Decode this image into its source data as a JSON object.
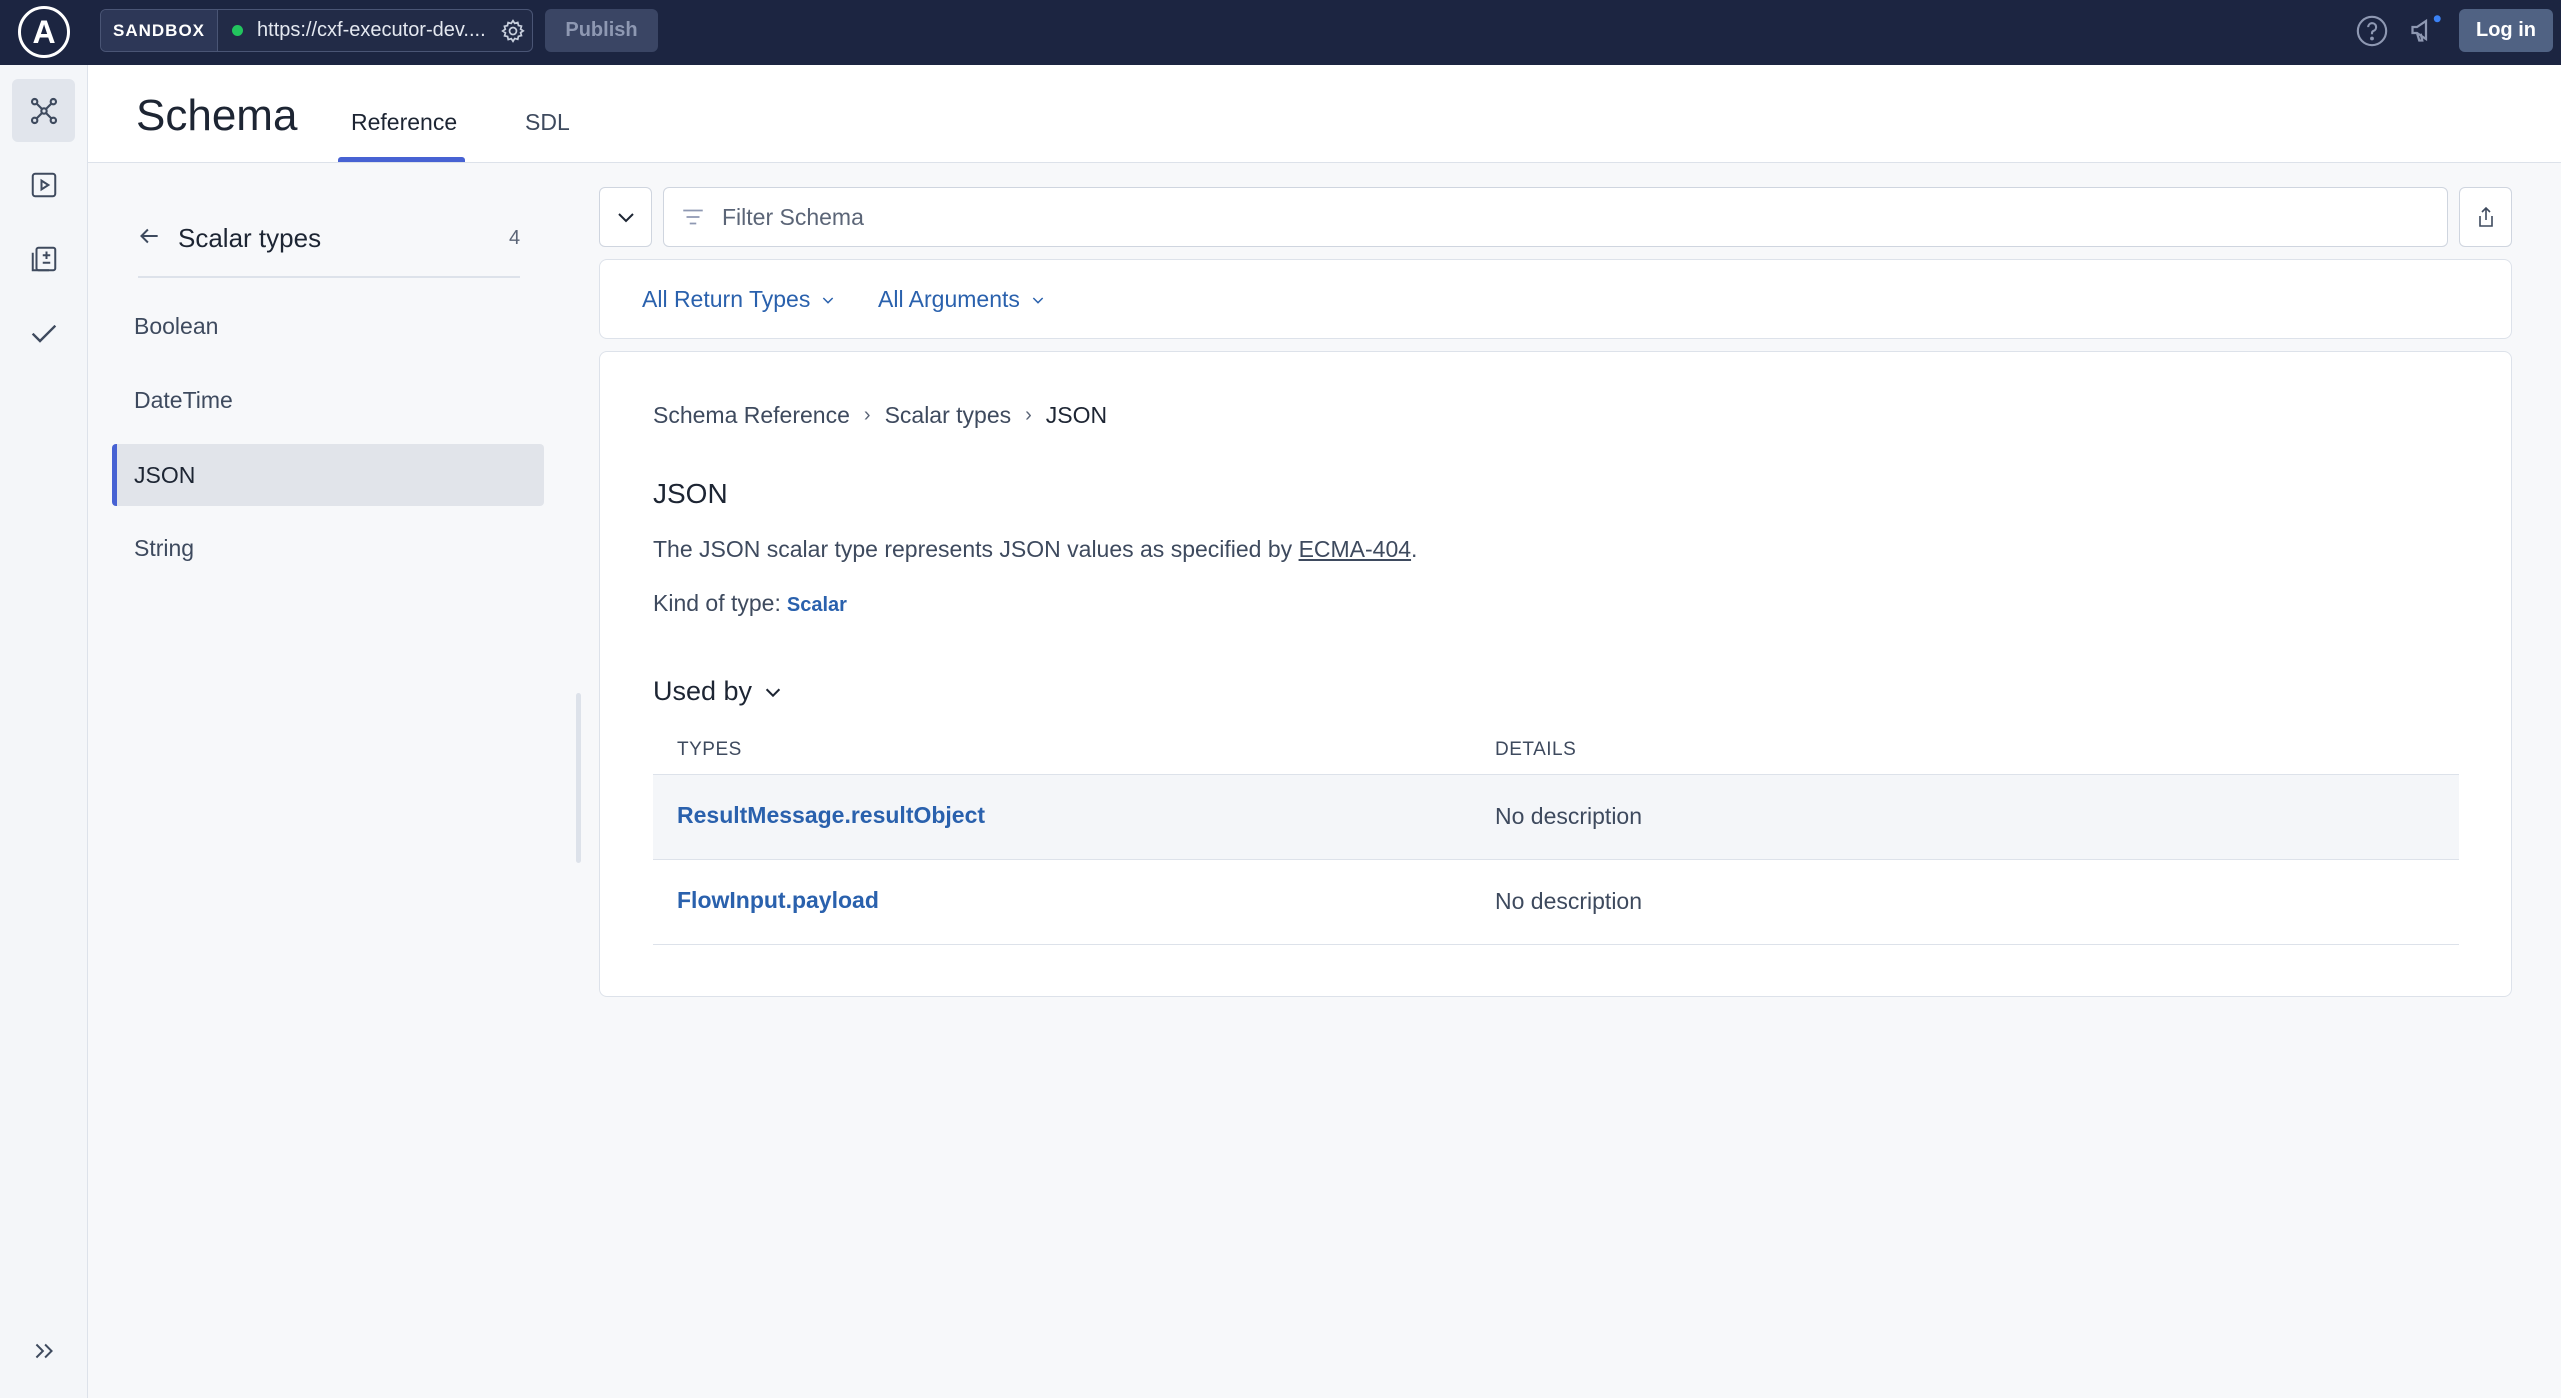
{
  "topbar": {
    "logo_letter": "A",
    "sandbox_label": "SANDBOX",
    "endpoint_url": "https://cxf-executor-dev....",
    "publish_label": "Publish",
    "login_label": "Log in",
    "colors": {
      "bg": "#1c2541",
      "status": "#22c55e"
    }
  },
  "rail": {
    "items": [
      {
        "icon": "schema-graph-icon",
        "active": true
      },
      {
        "icon": "explorer-play-icon",
        "active": false
      },
      {
        "icon": "collections-icon",
        "active": false
      },
      {
        "icon": "checks-icon",
        "active": false
      }
    ],
    "expand_icon": "expand-chevrons-icon"
  },
  "header": {
    "title": "Schema",
    "tabs": [
      {
        "label": "Reference",
        "active": true
      },
      {
        "label": "SDL",
        "active": false
      }
    ]
  },
  "sidebar": {
    "title": "Scalar types",
    "count": "4",
    "items": [
      {
        "label": "Boolean",
        "active": false
      },
      {
        "label": "DateTime",
        "active": false
      },
      {
        "label": "JSON",
        "active": true
      },
      {
        "label": "String",
        "active": false
      }
    ]
  },
  "filter": {
    "placeholder": "Filter Schema",
    "return_types_label": "All Return Types",
    "arguments_label": "All Arguments"
  },
  "detail": {
    "breadcrumb": [
      "Schema Reference",
      "Scalar types",
      "JSON"
    ],
    "title": "JSON",
    "description_prefix": "The JSON scalar type represents JSON values as specified by ",
    "description_link": "ECMA-404",
    "description_suffix": ".",
    "kind_label": "Kind of type:",
    "kind_value": "Scalar",
    "used_by_label": "Used by",
    "table": {
      "headers": [
        "TYPES",
        "DETAILS"
      ],
      "rows": [
        {
          "type": "ResultMessage.resultObject",
          "details": "No description"
        },
        {
          "type": "FlowInput.payload",
          "details": "No description"
        }
      ]
    }
  },
  "accent_color": "#4762d3",
  "link_color": "#2a61ad"
}
